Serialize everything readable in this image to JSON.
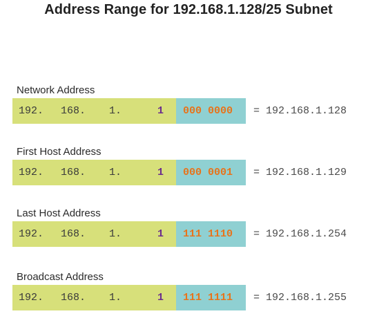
{
  "title": "Address Range for 192.168.1.128/25 Subnet",
  "rows": [
    {
      "label": "Network Address",
      "octet1": "192.",
      "octet2": "168.",
      "octet3": "1.",
      "network_bit": "1",
      "host_bits": "000 0000",
      "result": "= 192.168.1.128"
    },
    {
      "label": "First Host Address",
      "octet1": "192.",
      "octet2": "168.",
      "octet3": "1.",
      "network_bit": "1",
      "host_bits": "000 0001",
      "result": "= 192.168.1.129"
    },
    {
      "label": "Last Host Address",
      "octet1": "192.",
      "octet2": "168.",
      "octet3": "1.",
      "network_bit": "1",
      "host_bits": "111 1110",
      "result": "= 192.168.1.254"
    },
    {
      "label": "Broadcast Address",
      "octet1": "192.",
      "octet2": "168.",
      "octet3": "1.",
      "network_bit": "1",
      "host_bits": "111 1111",
      "result": "= 192.168.1.255"
    }
  ],
  "colors": {
    "network_portion": "#d7e07a",
    "host_portion": "#8fd0d2",
    "network_bit_text": "#6a2c8c",
    "host_bits_text": "#e8731a"
  }
}
